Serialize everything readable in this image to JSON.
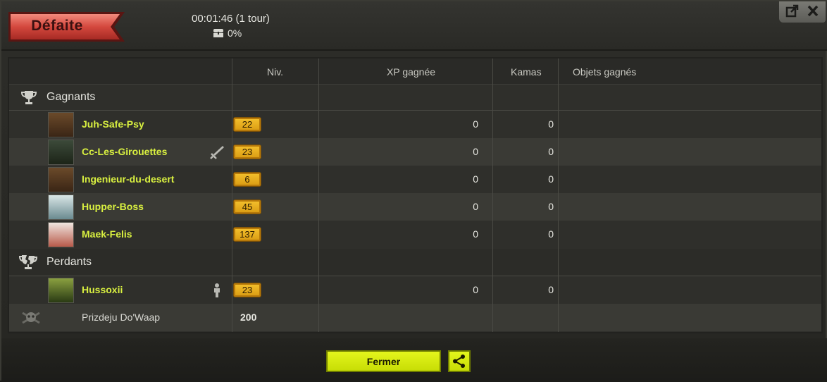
{
  "header": {
    "result_label": "Défaite",
    "timer": "00:01:46 (1 tour)",
    "loot_percent": "0%",
    "loot_icon": "chest-icon",
    "window_buttons": [
      "undock-icon",
      "close-icon"
    ]
  },
  "columns": {
    "level": "Niv.",
    "xp": "XP gagnée",
    "kamas": "Kamas",
    "items": "Objets gagnés"
  },
  "groups": {
    "winners": {
      "label": "Gagnants",
      "icon": "trophy-icon"
    },
    "losers": {
      "label": "Perdants",
      "icon": "broken-trophy-icon"
    }
  },
  "winners": [
    {
      "name": "Juh-Safe-Psy",
      "level": "22",
      "xp": "0",
      "kamas": "0",
      "side_icon": ""
    },
    {
      "name": "Cc-Les-Girouettes",
      "level": "23",
      "xp": "0",
      "kamas": "0",
      "side_icon": "sword-icon"
    },
    {
      "name": "Ingenieur-du-desert",
      "level": "6",
      "xp": "0",
      "kamas": "0",
      "side_icon": ""
    },
    {
      "name": "Hupper-Boss",
      "level": "45",
      "xp": "0",
      "kamas": "0",
      "side_icon": ""
    },
    {
      "name": "Maek-Felis",
      "level": "137",
      "xp": "0",
      "kamas": "0",
      "side_icon": ""
    }
  ],
  "losers": [
    {
      "name": "Hussoxii",
      "level": "23",
      "xp": "0",
      "kamas": "0",
      "side_icon": "person-icon"
    }
  ],
  "monster": {
    "name": "Prizdeju Do'Waap",
    "level": "200",
    "icon": "skull-icon"
  },
  "footer": {
    "close_label": "Fermer",
    "share_icon": "share-icon"
  },
  "colors": {
    "winner_name": "#d9f040",
    "button": "#d8ec10",
    "result_ribbon": "#c8403a"
  }
}
